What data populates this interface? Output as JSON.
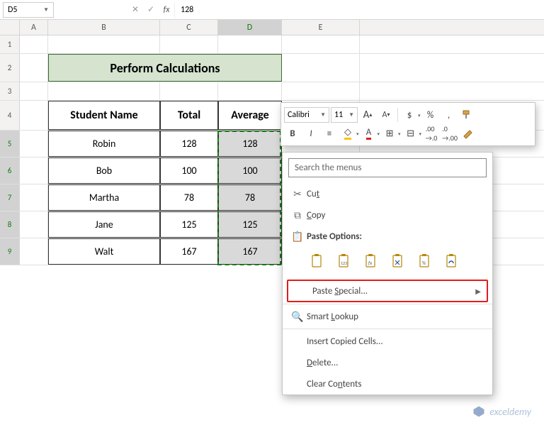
{
  "nameBox": "D5",
  "formulaValue": "128",
  "columns": [
    "A",
    "B",
    "C",
    "D",
    "E"
  ],
  "rows": [
    "1",
    "2",
    "3",
    "4",
    "5",
    "6",
    "7",
    "8",
    "9"
  ],
  "title": "Perform Calculations",
  "headers": {
    "name": "Student Name",
    "total": "Total",
    "avg": "Average"
  },
  "students": [
    {
      "name": "Robin",
      "total": "128",
      "avg": "128"
    },
    {
      "name": "Bob",
      "total": "100",
      "avg": "100"
    },
    {
      "name": "Martha",
      "total": "78",
      "avg": "78"
    },
    {
      "name": "Jane",
      "total": "125",
      "avg": "125"
    },
    {
      "name": "Walt",
      "total": "167",
      "avg": "167"
    }
  ],
  "miniToolbar": {
    "font": "Calibri",
    "size": "11",
    "btns": {
      "incFont": "A",
      "decFont": "A",
      "currency": "$",
      "percent": "%",
      "comma": ",",
      "bold": "B",
      "italic": "I"
    }
  },
  "contextMenu": {
    "searchPlaceholder": "Search the menus",
    "cut": "Cut",
    "copy": "Copy",
    "pasteOptions": "Paste Options:",
    "pasteSpecial": "Paste Special...",
    "smartLookup": "Smart Lookup",
    "insertCopied": "Insert Copied Cells...",
    "delete": "Delete...",
    "clearContents": "Clear Contents"
  },
  "watermark": "exceldemy"
}
